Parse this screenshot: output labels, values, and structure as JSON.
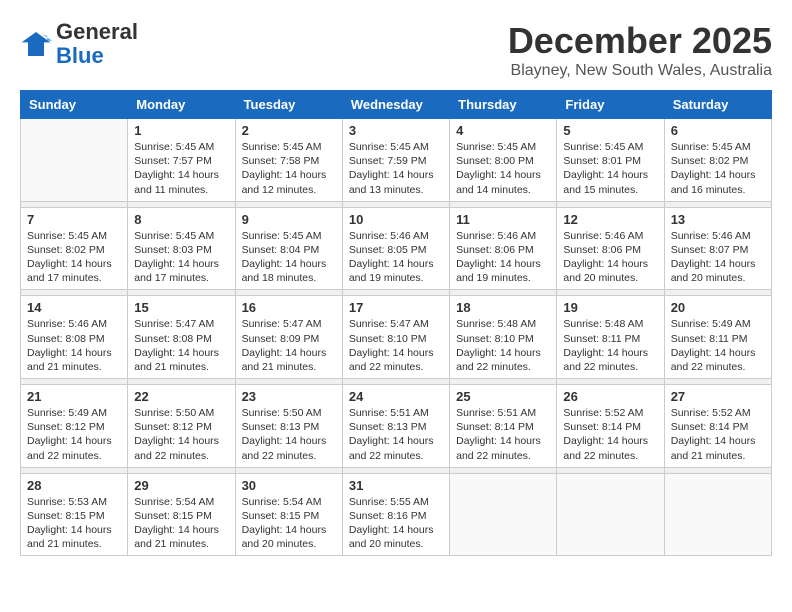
{
  "logo": {
    "general": "General",
    "blue": "Blue"
  },
  "header": {
    "month": "December 2025",
    "location": "Blayney, New South Wales, Australia"
  },
  "weekdays": [
    "Sunday",
    "Monday",
    "Tuesday",
    "Wednesday",
    "Thursday",
    "Friday",
    "Saturday"
  ],
  "weeks": [
    [
      {
        "day": "",
        "data": ""
      },
      {
        "day": "1",
        "data": "Sunrise: 5:45 AM\nSunset: 7:57 PM\nDaylight: 14 hours\nand 11 minutes."
      },
      {
        "day": "2",
        "data": "Sunrise: 5:45 AM\nSunset: 7:58 PM\nDaylight: 14 hours\nand 12 minutes."
      },
      {
        "day": "3",
        "data": "Sunrise: 5:45 AM\nSunset: 7:59 PM\nDaylight: 14 hours\nand 13 minutes."
      },
      {
        "day": "4",
        "data": "Sunrise: 5:45 AM\nSunset: 8:00 PM\nDaylight: 14 hours\nand 14 minutes."
      },
      {
        "day": "5",
        "data": "Sunrise: 5:45 AM\nSunset: 8:01 PM\nDaylight: 14 hours\nand 15 minutes."
      },
      {
        "day": "6",
        "data": "Sunrise: 5:45 AM\nSunset: 8:02 PM\nDaylight: 14 hours\nand 16 minutes."
      }
    ],
    [
      {
        "day": "7",
        "data": "Sunrise: 5:45 AM\nSunset: 8:02 PM\nDaylight: 14 hours\nand 17 minutes."
      },
      {
        "day": "8",
        "data": "Sunrise: 5:45 AM\nSunset: 8:03 PM\nDaylight: 14 hours\nand 17 minutes."
      },
      {
        "day": "9",
        "data": "Sunrise: 5:45 AM\nSunset: 8:04 PM\nDaylight: 14 hours\nand 18 minutes."
      },
      {
        "day": "10",
        "data": "Sunrise: 5:46 AM\nSunset: 8:05 PM\nDaylight: 14 hours\nand 19 minutes."
      },
      {
        "day": "11",
        "data": "Sunrise: 5:46 AM\nSunset: 8:06 PM\nDaylight: 14 hours\nand 19 minutes."
      },
      {
        "day": "12",
        "data": "Sunrise: 5:46 AM\nSunset: 8:06 PM\nDaylight: 14 hours\nand 20 minutes."
      },
      {
        "day": "13",
        "data": "Sunrise: 5:46 AM\nSunset: 8:07 PM\nDaylight: 14 hours\nand 20 minutes."
      }
    ],
    [
      {
        "day": "14",
        "data": "Sunrise: 5:46 AM\nSunset: 8:08 PM\nDaylight: 14 hours\nand 21 minutes."
      },
      {
        "day": "15",
        "data": "Sunrise: 5:47 AM\nSunset: 8:08 PM\nDaylight: 14 hours\nand 21 minutes."
      },
      {
        "day": "16",
        "data": "Sunrise: 5:47 AM\nSunset: 8:09 PM\nDaylight: 14 hours\nand 21 minutes."
      },
      {
        "day": "17",
        "data": "Sunrise: 5:47 AM\nSunset: 8:10 PM\nDaylight: 14 hours\nand 22 minutes."
      },
      {
        "day": "18",
        "data": "Sunrise: 5:48 AM\nSunset: 8:10 PM\nDaylight: 14 hours\nand 22 minutes."
      },
      {
        "day": "19",
        "data": "Sunrise: 5:48 AM\nSunset: 8:11 PM\nDaylight: 14 hours\nand 22 minutes."
      },
      {
        "day": "20",
        "data": "Sunrise: 5:49 AM\nSunset: 8:11 PM\nDaylight: 14 hours\nand 22 minutes."
      }
    ],
    [
      {
        "day": "21",
        "data": "Sunrise: 5:49 AM\nSunset: 8:12 PM\nDaylight: 14 hours\nand 22 minutes."
      },
      {
        "day": "22",
        "data": "Sunrise: 5:50 AM\nSunset: 8:12 PM\nDaylight: 14 hours\nand 22 minutes."
      },
      {
        "day": "23",
        "data": "Sunrise: 5:50 AM\nSunset: 8:13 PM\nDaylight: 14 hours\nand 22 minutes."
      },
      {
        "day": "24",
        "data": "Sunrise: 5:51 AM\nSunset: 8:13 PM\nDaylight: 14 hours\nand 22 minutes."
      },
      {
        "day": "25",
        "data": "Sunrise: 5:51 AM\nSunset: 8:14 PM\nDaylight: 14 hours\nand 22 minutes."
      },
      {
        "day": "26",
        "data": "Sunrise: 5:52 AM\nSunset: 8:14 PM\nDaylight: 14 hours\nand 22 minutes."
      },
      {
        "day": "27",
        "data": "Sunrise: 5:52 AM\nSunset: 8:14 PM\nDaylight: 14 hours\nand 21 minutes."
      }
    ],
    [
      {
        "day": "28",
        "data": "Sunrise: 5:53 AM\nSunset: 8:15 PM\nDaylight: 14 hours\nand 21 minutes."
      },
      {
        "day": "29",
        "data": "Sunrise: 5:54 AM\nSunset: 8:15 PM\nDaylight: 14 hours\nand 21 minutes."
      },
      {
        "day": "30",
        "data": "Sunrise: 5:54 AM\nSunset: 8:15 PM\nDaylight: 14 hours\nand 20 minutes."
      },
      {
        "day": "31",
        "data": "Sunrise: 5:55 AM\nSunset: 8:16 PM\nDaylight: 14 hours\nand 20 minutes."
      },
      {
        "day": "",
        "data": ""
      },
      {
        "day": "",
        "data": ""
      },
      {
        "day": "",
        "data": ""
      }
    ]
  ]
}
